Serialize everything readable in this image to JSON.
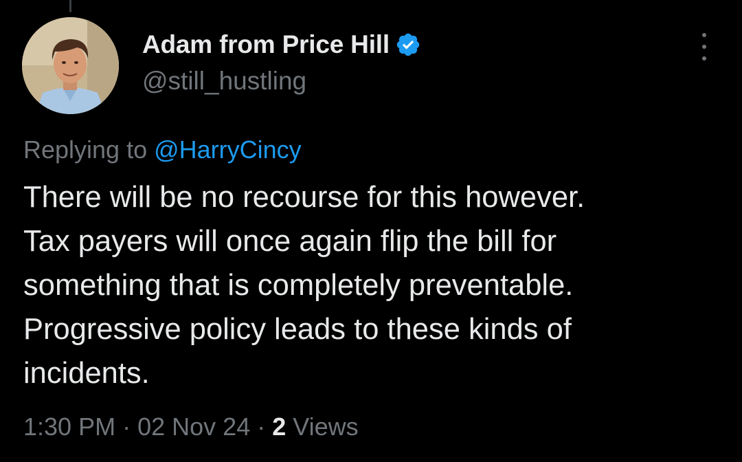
{
  "author": {
    "display_name": "Adam from Price Hill",
    "handle": "@still_hustling",
    "verified": true,
    "avatar_icon": "profile-photo"
  },
  "reply": {
    "prefix": "Replying to ",
    "mention": "@HarryCincy"
  },
  "tweet": {
    "lines": [
      "There will be no recourse for this however.",
      "Tax payers will once again flip the bill for",
      "something that is completely preventable.",
      "Progressive policy leads to these kinds of",
      "incidents."
    ]
  },
  "meta": {
    "time": "1:30 PM",
    "date": "02 Nov 24",
    "views_count": "2",
    "views_label": "Views",
    "separator": "·"
  },
  "colors": {
    "background": "#000000",
    "text": "#e7e9ea",
    "secondary": "#71767b",
    "accent": "#1d9bf0"
  },
  "icons": {
    "verified": "verified-badge-icon",
    "more": "more-options-icon"
  }
}
